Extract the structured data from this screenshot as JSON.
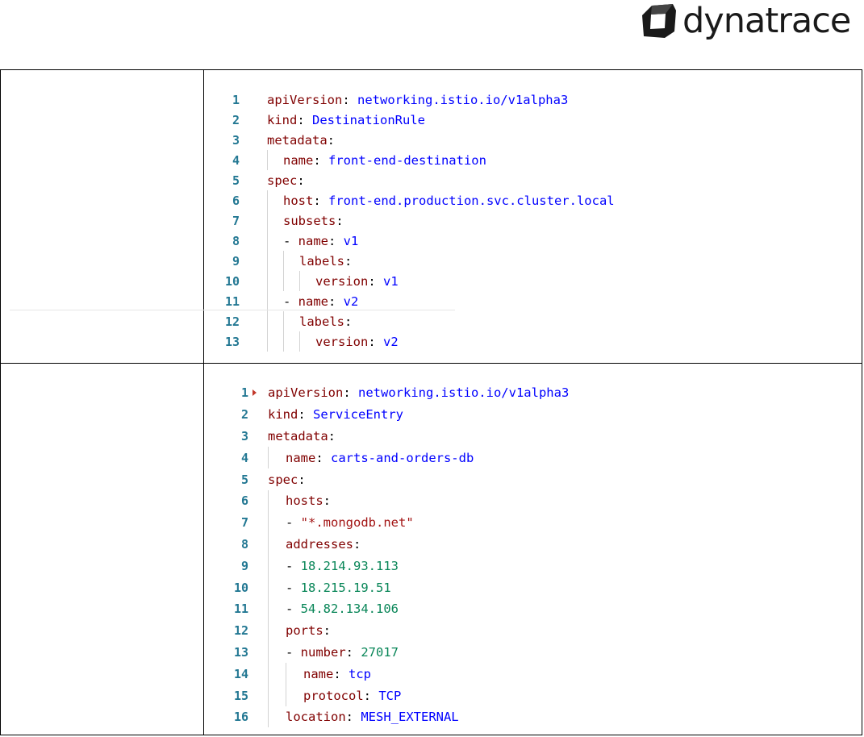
{
  "brand": {
    "logo_text": "dynatrace",
    "logo_icon": "dynatrace-cube-icon"
  },
  "colors": {
    "key": "#800000",
    "string": "#0000ff",
    "number": "#098658",
    "quoted_string": "#a31515",
    "line_number": "#237893"
  },
  "block1": {
    "lines": [
      {
        "n": "1",
        "k": "apiVersion",
        "v": "networking.istio.io/v1alpha3"
      },
      {
        "n": "2",
        "k": "kind",
        "v": "DestinationRule"
      },
      {
        "n": "3",
        "k": "metadata",
        "v": ""
      },
      {
        "n": "4",
        "k": "name",
        "v": "front-end-destination"
      },
      {
        "n": "5",
        "k": "spec",
        "v": ""
      },
      {
        "n": "6",
        "k": "host",
        "v": "front-end.production.svc.cluster.local"
      },
      {
        "n": "7",
        "k": "subsets",
        "v": ""
      },
      {
        "n": "8",
        "k": "name",
        "v": "v1"
      },
      {
        "n": "9",
        "k": "labels",
        "v": ""
      },
      {
        "n": "10",
        "k": "version",
        "v": "v1"
      },
      {
        "n": "11",
        "k": "name",
        "v": "v2"
      },
      {
        "n": "12",
        "k": "labels",
        "v": ""
      },
      {
        "n": "13",
        "k": "version",
        "v": "v2"
      }
    ]
  },
  "block2": {
    "lines": [
      {
        "n": "1",
        "k": "apiVersion",
        "v": "networking.istio.io/v1alpha3"
      },
      {
        "n": "2",
        "k": "kind",
        "v": "ServiceEntry"
      },
      {
        "n": "3",
        "k": "metadata",
        "v": ""
      },
      {
        "n": "4",
        "k": "name",
        "v": "carts-and-orders-db"
      },
      {
        "n": "5",
        "k": "spec",
        "v": ""
      },
      {
        "n": "6",
        "k": "hosts",
        "v": ""
      },
      {
        "n": "7",
        "k": "",
        "v": "\"*.mongodb.net\""
      },
      {
        "n": "8",
        "k": "addresses",
        "v": ""
      },
      {
        "n": "9",
        "k": "",
        "v": "18.214.93.113"
      },
      {
        "n": "10",
        "k": "",
        "v": "18.215.19.51"
      },
      {
        "n": "11",
        "k": "",
        "v": "54.82.134.106"
      },
      {
        "n": "12",
        "k": "ports",
        "v": ""
      },
      {
        "n": "13",
        "k": "number",
        "v": "27017"
      },
      {
        "n": "14",
        "k": "name",
        "v": "tcp"
      },
      {
        "n": "15",
        "k": "protocol",
        "v": "TCP"
      },
      {
        "n": "16",
        "k": "location",
        "v": "MESH_EXTERNAL"
      }
    ]
  }
}
